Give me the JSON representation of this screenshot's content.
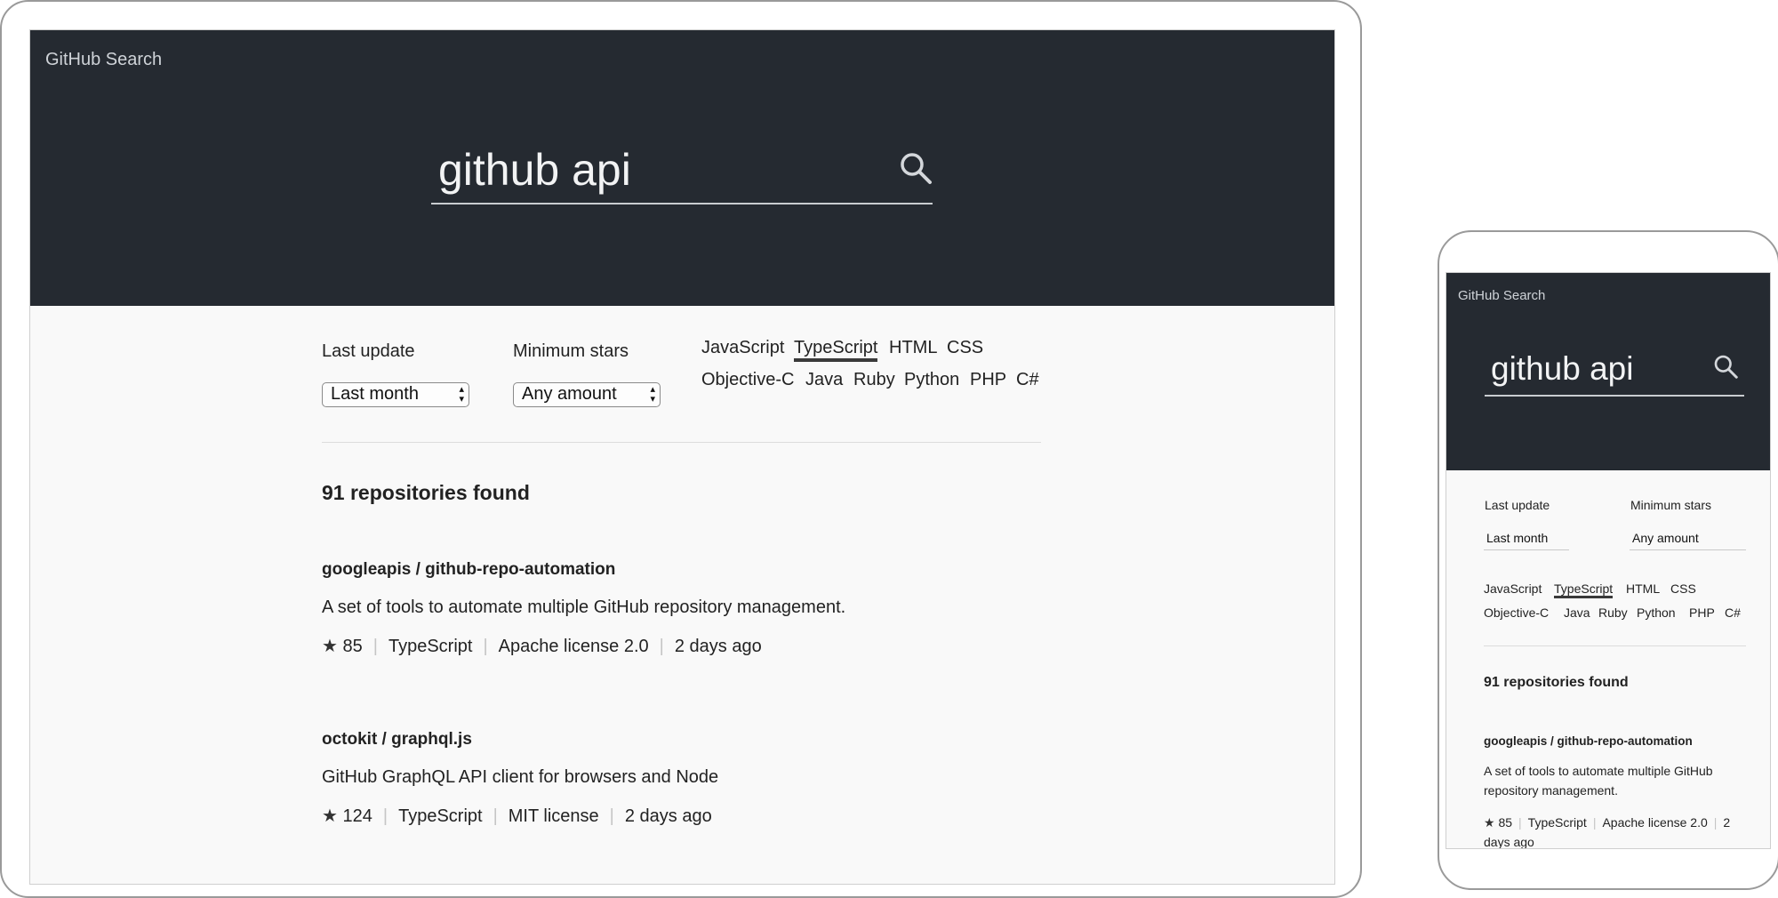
{
  "app": {
    "title": "GitHub Search"
  },
  "search": {
    "query": "github api"
  },
  "filters": {
    "last_update_label": "Last update",
    "last_update_value": "Last month",
    "min_stars_label": "Minimum stars",
    "min_stars_value": "Any amount"
  },
  "languages": [
    "JavaScript",
    "TypeScript",
    "HTML",
    "CSS",
    "Objective-C",
    "Java",
    "Ruby",
    "Python",
    "PHP",
    "C#"
  ],
  "active_language": "TypeScript",
  "results": {
    "count_text": "91 repositories found",
    "repos": [
      {
        "name": "googleapis / github-repo-automation",
        "description": "A set of tools to automate multiple GitHub repository management.",
        "stars": "85",
        "language": "TypeScript",
        "license": "Apache license 2.0",
        "updated": "2 days ago"
      },
      {
        "name": "octokit / graphql.js",
        "description": "GitHub GraphQL API client for browsers and Node",
        "stars": "124",
        "language": "TypeScript",
        "license": "MIT license",
        "updated": "2 days ago"
      }
    ]
  },
  "icons": {
    "search": "search-icon",
    "star": "star-icon",
    "select_caret": "up-down-caret-icon"
  }
}
